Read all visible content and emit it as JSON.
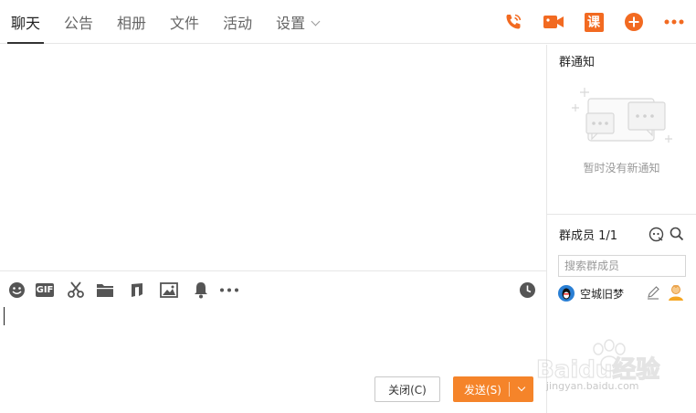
{
  "tabs": [
    {
      "label": "聊天",
      "active": true
    },
    {
      "label": "公告",
      "active": false
    },
    {
      "label": "相册",
      "active": false
    },
    {
      "label": "文件",
      "active": false
    },
    {
      "label": "活动",
      "active": false
    },
    {
      "label": "设置",
      "active": false,
      "has_dropdown": true
    }
  ],
  "toolbar_icons": [
    "phone-icon",
    "video-call-icon",
    "lesson-icon",
    "add-icon",
    "more-icon"
  ],
  "lesson_icon_text": "课",
  "accent_color": "#f26a21",
  "input_toolbar": [
    "emoji-icon",
    "gif-icon",
    "scissors-icon",
    "folder-icon",
    "music-icon",
    "image-icon",
    "bell-icon",
    "more-dots-icon",
    "history-clock-icon"
  ],
  "gif_label": "GIF",
  "buttons": {
    "close": "关闭(C)",
    "send": "发送(S)"
  },
  "notice": {
    "title": "群通知",
    "empty_text": "暂时没有新通知"
  },
  "members": {
    "title": "群成员 1/1",
    "search_placeholder": "搜索群成员",
    "list": [
      {
        "name": "空城旧梦"
      }
    ]
  },
  "watermark": {
    "brand": "Baidu经验",
    "url": "jingyan.baidu.com"
  }
}
